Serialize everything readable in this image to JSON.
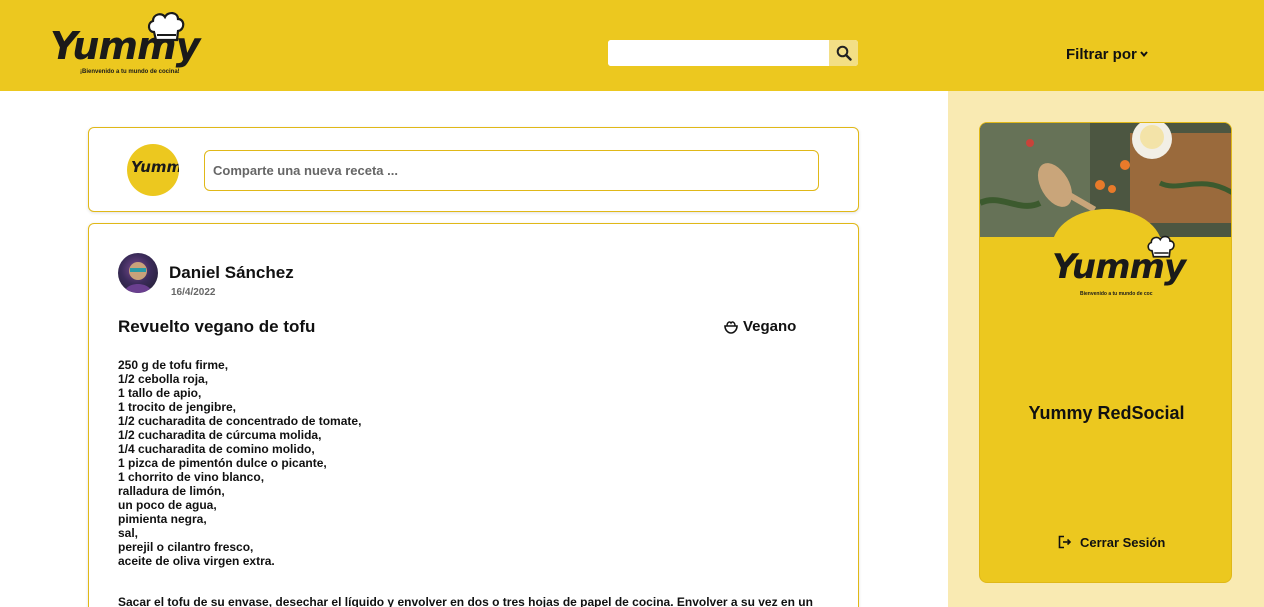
{
  "header": {
    "logo_text": "Yummy",
    "logo_tagline": "¡Bienvenido a tu mundo de cocina!",
    "search_placeholder": "",
    "filter_label": "Filtrar por"
  },
  "new_post": {
    "avatar_text": "Yummy",
    "placeholder": "Comparte una nueva receta ..."
  },
  "post": {
    "author": "Daniel Sánchez",
    "date": "16/4/2022",
    "title": "Revuelto vegano de tofu",
    "category": "Vegano",
    "ingredients": [
      "250 g de tofu firme,",
      "1/2 cebolla roja,",
      "1 tallo de apio,",
      "1 trocito de jengibre,",
      "1/2 cucharadita de concentrado de tomate,",
      "1/2 cucharadita de cúrcuma molida,",
      "1/4 cucharadita de comino molido,",
      "1 pizca de pimentón dulce o picante,",
      "1 chorrito de vino blanco,",
      "ralladura de limón,",
      "un poco de agua,",
      "pimienta negra,",
      "sal,",
      "perejil o cilantro fresco,",
      "aceite de oliva virgen extra."
    ],
    "instructions": "Sacar el tofu de su envase, desechar el líquido y envolver en dos o tres hojas de papel de cocina. Envolver a su vez en un"
  },
  "profile_card": {
    "logo_text": "Yummy",
    "logo_tagline": "Bienvenido a tu mundo de coc",
    "name": "Yummy RedSocial",
    "logout_label": "Cerrar Sesión"
  },
  "colors": {
    "brand_yellow": "#ecc81f",
    "panel_bg": "#f9eab2",
    "text": "#111111"
  },
  "icons": [
    "chef-hat-icon",
    "search-icon",
    "chevron-down-icon",
    "bowl-icon",
    "logout-icon"
  ]
}
